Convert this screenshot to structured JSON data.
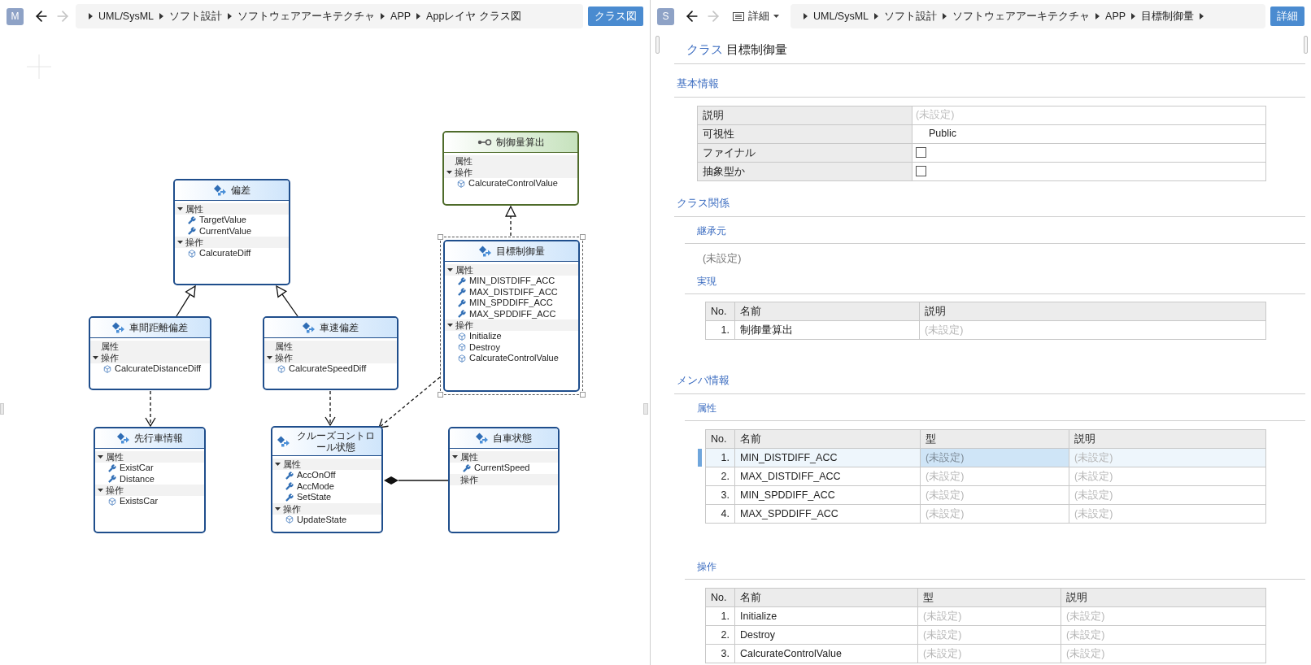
{
  "left_pane": {
    "avatar": "M",
    "back_enabled": true,
    "forward_enabled": false,
    "breadcrumb": {
      "items": [
        "UML/SysML",
        "ソフト設計",
        "ソフトウェアアーキテクチャ",
        "APP",
        "Appレイヤ クラス図"
      ],
      "trailing_caret": false
    },
    "button": "クラス図"
  },
  "diagram": {
    "classes": [
      {
        "kind": "class",
        "name": "偏差",
        "selected": false,
        "sections": [
          {
            "kind": "attributes",
            "label": "属性",
            "toggle": true,
            "items": [
              "TargetValue",
              "CurrentValue"
            ]
          },
          {
            "kind": "operations",
            "label": "操作",
            "toggle": true,
            "items": [
              "CalcurateDiff"
            ]
          }
        ]
      },
      {
        "kind": "interface",
        "name": "制御量算出",
        "selected": false,
        "sections": [
          {
            "kind": "attributes",
            "label": "属性",
            "toggle": false
          },
          {
            "kind": "operations",
            "label": "操作",
            "toggle": true,
            "items": [
              "CalcurateControlValue"
            ]
          }
        ]
      },
      {
        "kind": "class",
        "name": "目標制御量",
        "selected": true,
        "sections": [
          {
            "kind": "attributes",
            "label": "属性",
            "toggle": true,
            "items": [
              "MIN_DISTDIFF_ACC",
              "MAX_DISTDIFF_ACC",
              "MIN_SPDDIFF_ACC",
              "MAX_SPDDIFF_ACC"
            ]
          },
          {
            "kind": "operations",
            "label": "操作",
            "toggle": true,
            "items": [
              "Initialize",
              "Destroy",
              "CalcurateControlValue"
            ]
          }
        ]
      },
      {
        "kind": "class",
        "name": "車間距離偏差",
        "selected": false,
        "sections": [
          {
            "kind": "attributes",
            "label": "属性",
            "toggle": false
          },
          {
            "kind": "operations",
            "label": "操作",
            "toggle": true,
            "items": [
              "CalcurateDistanceDiff"
            ]
          }
        ]
      },
      {
        "kind": "class",
        "name": "車速偏差",
        "selected": false,
        "sections": [
          {
            "kind": "attributes",
            "label": "属性",
            "toggle": false
          },
          {
            "kind": "operations",
            "label": "操作",
            "toggle": true,
            "items": [
              "CalcurateSpeedDiff"
            ]
          }
        ]
      },
      {
        "kind": "class",
        "name": "先行車情報",
        "selected": false,
        "sections": [
          {
            "kind": "attributes",
            "label": "属性",
            "toggle": true,
            "items": [
              "ExistCar",
              "Distance"
            ]
          },
          {
            "kind": "operations",
            "label": "操作",
            "toggle": true,
            "items": [
              "ExistsCar"
            ]
          }
        ]
      },
      {
        "kind": "class",
        "name": "クルーズコントロール状態",
        "selected": false,
        "sections": [
          {
            "kind": "attributes",
            "label": "属性",
            "toggle": true,
            "items": [
              "AccOnOff",
              "AccMode",
              "SetState"
            ]
          },
          {
            "kind": "operations",
            "label": "操作",
            "toggle": true,
            "items": [
              "UpdateState"
            ]
          }
        ]
      },
      {
        "kind": "class",
        "name": "自車状態",
        "selected": false,
        "sections": [
          {
            "kind": "attributes",
            "label": "属性",
            "toggle": true,
            "items": [
              "CurrentSpeed"
            ]
          },
          {
            "kind": "operations",
            "label": "操作",
            "toggle": false
          }
        ]
      }
    ],
    "edges": [
      {
        "kind": "generalization"
      },
      {
        "kind": "generalization"
      },
      {
        "kind": "realization"
      },
      {
        "kind": "dependency"
      },
      {
        "kind": "dependency"
      },
      {
        "kind": "dependency"
      },
      {
        "kind": "composition"
      }
    ]
  },
  "right_pane": {
    "avatar": "S",
    "back_enabled": true,
    "forward_enabled": false,
    "view_menu": "詳細",
    "breadcrumb": {
      "items": [
        "UML/SysML",
        "ソフト設計",
        "ソフトウェアアーキテクチャ",
        "APP",
        "目標制御量"
      ],
      "trailing_caret": true
    },
    "button": "詳細",
    "title": {
      "kind": "クラス",
      "name": "目標制御量"
    },
    "basic_info": {
      "heading": "基本情報",
      "rows": [
        {
          "label": "説明",
          "kind": "text",
          "value": "(未設定)",
          "unset": true
        },
        {
          "label": "可視性",
          "kind": "text",
          "value": "Public",
          "unset": false
        },
        {
          "label": "ファイナル",
          "kind": "checkbox",
          "checked": false
        },
        {
          "label": "抽象型か",
          "kind": "checkbox",
          "checked": false
        }
      ]
    },
    "class_relations": {
      "heading": "クラス関係",
      "inheritance": {
        "heading": "継承元",
        "value": "(未設定)"
      },
      "realization": {
        "heading": "実現",
        "columns": [
          "No.",
          "名前",
          "説明"
        ],
        "rows": [
          {
            "selected": false,
            "cells": [
              {
                "text": "1.",
                "unset": false
              },
              {
                "text": "制御量算出",
                "unset": false
              },
              {
                "text": "(未設定)",
                "unset": true
              }
            ]
          }
        ]
      }
    },
    "members": {
      "heading": "メンバ情報",
      "attributes": {
        "heading": "属性",
        "columns": [
          "No.",
          "名前",
          "型",
          "説明"
        ],
        "rows": [
          {
            "selected": true,
            "cells": [
              {
                "text": "1.",
                "unset": false,
                "focused": false
              },
              {
                "text": "MIN_DISTDIFF_ACC",
                "unset": false,
                "focused": false
              },
              {
                "text": "(未設定)",
                "unset": true,
                "focused": true
              },
              {
                "text": "(未設定)",
                "unset": true,
                "focused": false
              }
            ]
          },
          {
            "selected": false,
            "cells": [
              {
                "text": "2.",
                "unset": false,
                "focused": false
              },
              {
                "text": "MAX_DISTDIFF_ACC",
                "unset": false,
                "focused": false
              },
              {
                "text": "(未設定)",
                "unset": true,
                "focused": false
              },
              {
                "text": "(未設定)",
                "unset": true,
                "focused": false
              }
            ]
          },
          {
            "selected": false,
            "cells": [
              {
                "text": "3.",
                "unset": false,
                "focused": false
              },
              {
                "text": "MIN_SPDDIFF_ACC",
                "unset": false,
                "focused": false
              },
              {
                "text": "(未設定)",
                "unset": true,
                "focused": false
              },
              {
                "text": "(未設定)",
                "unset": true,
                "focused": false
              }
            ]
          },
          {
            "selected": false,
            "cells": [
              {
                "text": "4.",
                "unset": false,
                "focused": false
              },
              {
                "text": "MAX_SPDDIFF_ACC",
                "unset": false,
                "focused": false
              },
              {
                "text": "(未設定)",
                "unset": true,
                "focused": false
              },
              {
                "text": "(未設定)",
                "unset": true,
                "focused": false
              }
            ]
          }
        ]
      },
      "operations": {
        "heading": "操作",
        "columns": [
          "No.",
          "名前",
          "型",
          "説明"
        ],
        "rows": [
          {
            "selected": false,
            "cells": [
              {
                "text": "1.",
                "unset": false
              },
              {
                "text": "Initialize",
                "unset": false
              },
              {
                "text": "(未設定)",
                "unset": true
              },
              {
                "text": "(未設定)",
                "unset": true
              }
            ]
          },
          {
            "selected": false,
            "cells": [
              {
                "text": "2.",
                "unset": false
              },
              {
                "text": "Destroy",
                "unset": false
              },
              {
                "text": "(未設定)",
                "unset": true
              },
              {
                "text": "(未設定)",
                "unset": true
              }
            ]
          },
          {
            "selected": false,
            "cells": [
              {
                "text": "3.",
                "unset": false
              },
              {
                "text": "CalcurateControlValue",
                "unset": false
              },
              {
                "text": "(未設定)",
                "unset": true
              },
              {
                "text": "(未設定)",
                "unset": true
              }
            ]
          }
        ]
      }
    }
  }
}
